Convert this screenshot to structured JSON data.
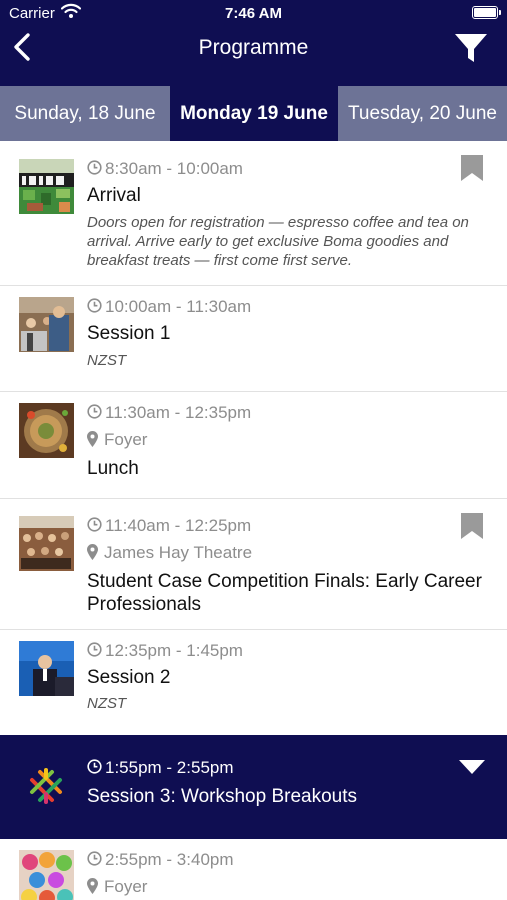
{
  "status": {
    "carrier": "Carrier",
    "time": "7:46 AM"
  },
  "header": {
    "title": "Programme"
  },
  "day_tabs": [
    {
      "label": "Sunday, 18 June"
    },
    {
      "label": "Monday 19 June",
      "selected": true
    },
    {
      "label": "Tuesday, 20 June"
    }
  ],
  "sessions": [
    {
      "time": "8:30am - 10:00am",
      "title": "Arrival",
      "description": "Doors open for registration — espresso coffee and tea on arrival. Arrive early to get exclusive Boma goodies and breakfast treats — first come first serve.",
      "bookmark": true
    },
    {
      "time": "10:00am - 11:30am",
      "title": "Session 1",
      "timezone": "NZST"
    },
    {
      "time": "11:30am - 12:35pm",
      "location": "Foyer",
      "title": "Lunch"
    },
    {
      "time": "11:40am - 12:25pm",
      "location": "James Hay Theatre",
      "title": "Student Case Competition Finals: Early Career Professionals",
      "bookmark": true
    },
    {
      "time": "12:35pm - 1:45pm",
      "title": "Session 2",
      "timezone": "NZST"
    },
    {
      "time": "1:55pm - 2:55pm",
      "title": "Session 3: Workshop Breakouts",
      "expandable": true
    },
    {
      "time": "2:55pm - 3:40pm",
      "location": "Foyer"
    }
  ],
  "colors": {
    "navy": "#0f0e52",
    "tab_inactive": "#6d7396",
    "muted_text": "#8d8d8d",
    "bookmark": "#9a9a9a"
  },
  "icons": [
    "wifi-icon",
    "battery-icon",
    "back-arrow-icon",
    "filter-icon",
    "clock-icon",
    "location-pin-icon",
    "bookmark-icon",
    "dropdown-arrow-icon",
    "workshop-logo-icon"
  ]
}
